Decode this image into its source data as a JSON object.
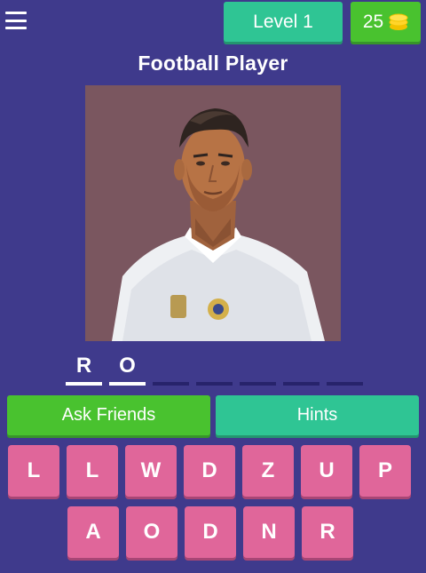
{
  "header": {
    "level_label": "Level 1",
    "coins": "25",
    "icons": {
      "menu": "menu-icon",
      "coins": "coins-icon"
    },
    "colors": {
      "level": "#2fc594",
      "coins": "#49c22f"
    }
  },
  "question": {
    "title": "Football Player"
  },
  "answer": {
    "slots": [
      "R",
      "O",
      "",
      "",
      "",
      "",
      ""
    ]
  },
  "actions": {
    "ask_friends": "Ask Friends",
    "hints": "Hints"
  },
  "keyboard": {
    "row1": [
      "L",
      "L",
      "W",
      "D",
      "Z",
      "U",
      "P"
    ],
    "row2": [
      "A",
      "O",
      "D",
      "N",
      "R"
    ],
    "key_color": "#e0669a"
  },
  "background_color": "#3f3a8c"
}
